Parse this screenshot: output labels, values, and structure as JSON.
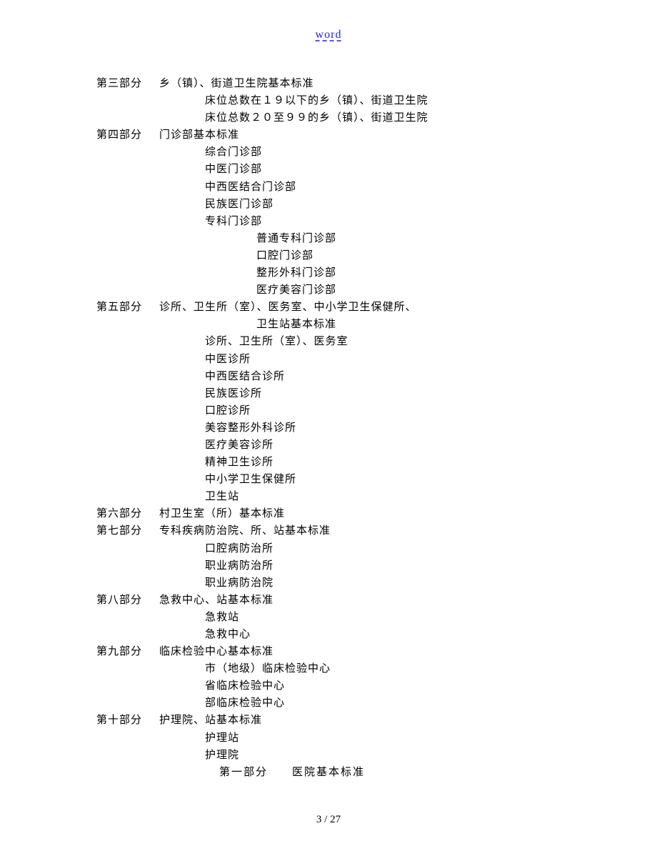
{
  "header": {
    "link": "word"
  },
  "footer": {
    "text": "3  / 27"
  },
  "toc": {
    "part3": {
      "label": "第三部分",
      "title": "乡（镇）、街道卫生院基本标准",
      "items": [
        "床位总数在１９以下的乡（镇）、街道卫生院",
        "床位总数２０至９９的乡（镇）、街道卫生院"
      ]
    },
    "part4": {
      "label": "第四部分",
      "title": "门诊部基本标准",
      "items": [
        "综合门诊部",
        "中医门诊部",
        "中西医结合门诊部",
        "民族医门诊部",
        "专科门诊部"
      ],
      "subitems": [
        "普通专科门诊部",
        "口腔门诊部",
        "整形外科门诊部",
        "医疗美容门诊部"
      ]
    },
    "part5": {
      "label": "第五部分",
      "title": "诊所、卫生所（室）、医务室、中小学卫生保健所、",
      "title2": "卫生站基本标准",
      "items": [
        "诊所、卫生所（室）、医务室",
        "中医诊所",
        "中西医结合诊所",
        "民族医诊所",
        "口腔诊所",
        "美容整形外科诊所",
        "医疗美容诊所",
        "精神卫生诊所",
        "中小学卫生保健所",
        "卫生站"
      ]
    },
    "part6": {
      "label": "第六部分",
      "title": "村卫生室（所）基本标准"
    },
    "part7": {
      "label": "第七部分",
      "title": "专科疾病防治院、所、站基本标准",
      "items": [
        "口腔病防治所",
        "职业病防治所",
        "职业病防治院"
      ]
    },
    "part8": {
      "label": "第八部分",
      "title": "急救中心、站基本标准",
      "items": [
        "急救站",
        "急救中心"
      ]
    },
    "part9": {
      "label": "第九部分",
      "title": "临床检验中心基本标准",
      "items": [
        "市（地级）临床检验中心",
        "省临床检验中心",
        "部临床检验中心"
      ]
    },
    "part10": {
      "label": "第十部分",
      "title": "护理院、站基本标准",
      "items": [
        "护理站",
        "护理院"
      ]
    },
    "section_heading": "第一部分　　医院基本标准"
  }
}
